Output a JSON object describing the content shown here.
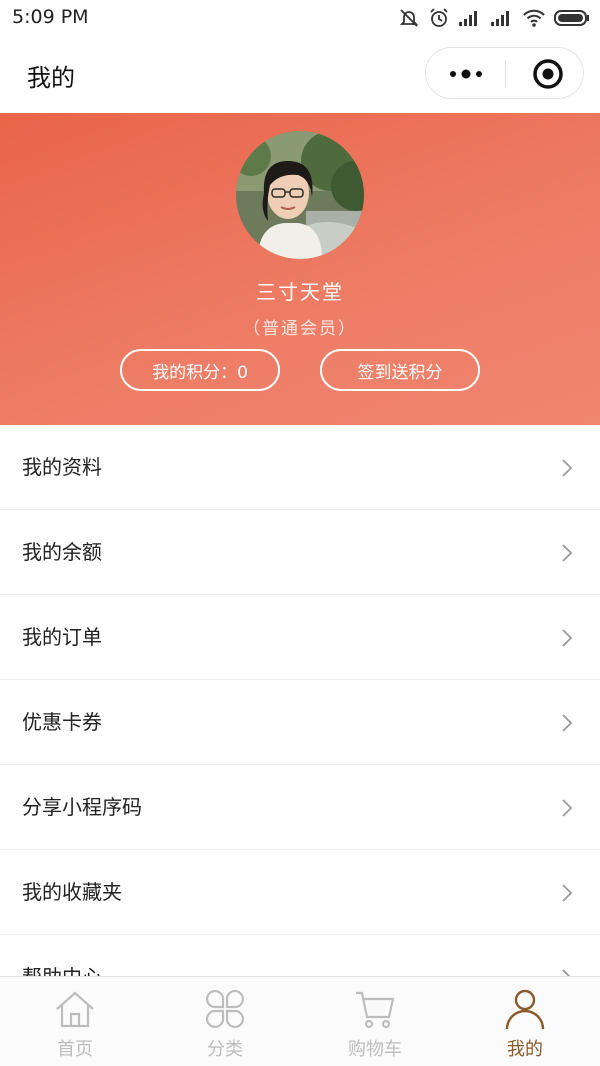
{
  "status_bar": {
    "time": "5:09 PM"
  },
  "nav": {
    "title": "我的"
  },
  "profile": {
    "name": "三寸天堂",
    "level": "（普通会员）",
    "points_button": "我的积分：0",
    "signin_button": "签到送积分"
  },
  "menu": {
    "items": [
      {
        "label": "我的资料"
      },
      {
        "label": "我的余额"
      },
      {
        "label": "我的订单"
      },
      {
        "label": "优惠卡券"
      },
      {
        "label": "分享小程序码"
      },
      {
        "label": "我的收藏夹"
      },
      {
        "label": "帮助中心"
      }
    ]
  },
  "tabs": [
    {
      "label": "首页",
      "icon": "home-icon",
      "active": false
    },
    {
      "label": "分类",
      "icon": "category-icon",
      "active": false
    },
    {
      "label": "购物车",
      "icon": "cart-icon",
      "active": false
    },
    {
      "label": "我的",
      "icon": "user-icon",
      "active": true
    }
  ],
  "colors": {
    "header_start": "#e9654a",
    "header_end": "#f08570",
    "active_tab": "#8b5a2b",
    "inactive_tab": "#bdbdbd"
  }
}
